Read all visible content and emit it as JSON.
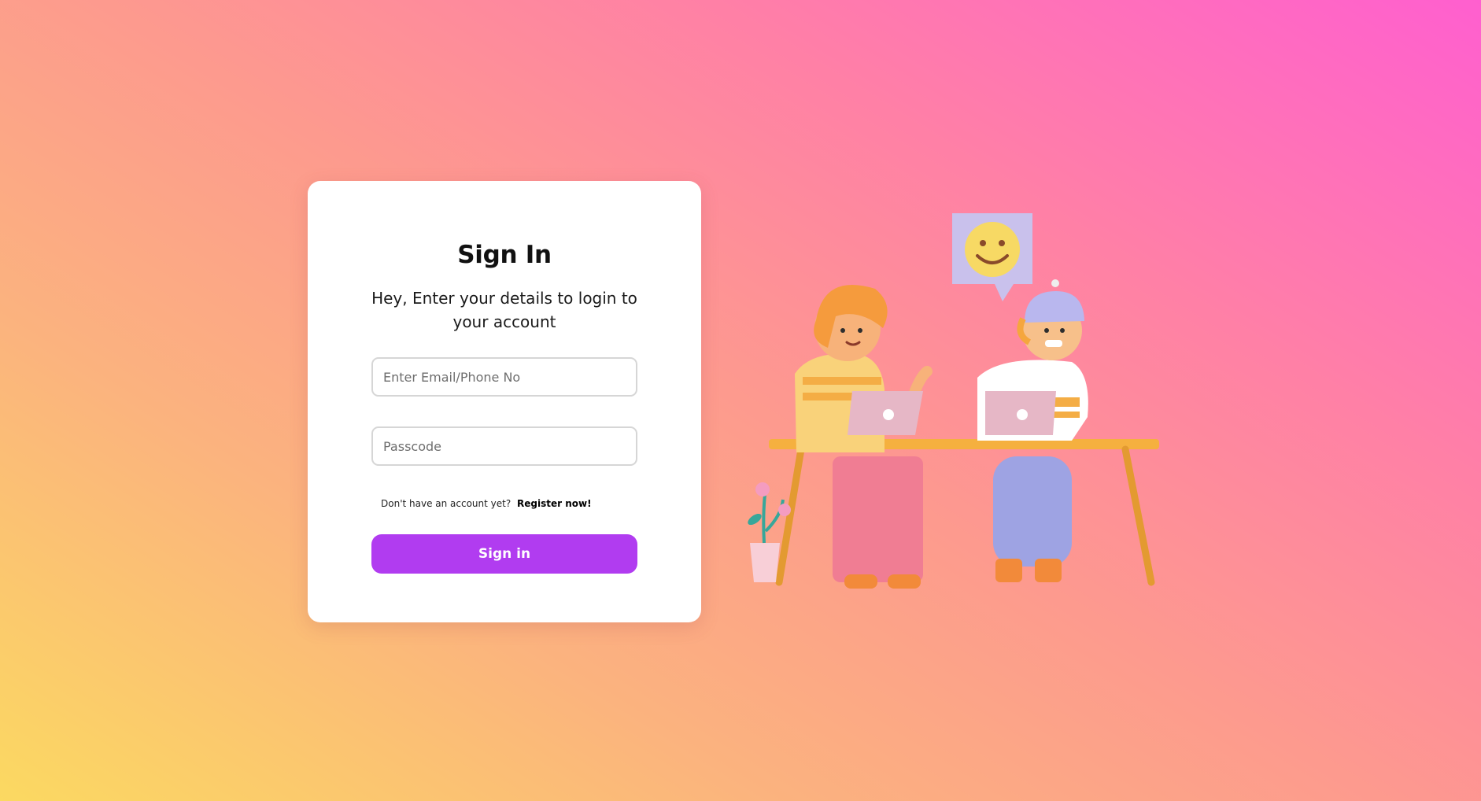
{
  "login": {
    "title": "Sign In",
    "subtitle": "Hey, Enter your details to login to your account",
    "email_placeholder": "Enter Email/Phone No",
    "password_placeholder": "Passcode",
    "register_prompt": "Don't have an account yet?",
    "register_link": "Register now!",
    "signin_label": "Sign in"
  },
  "colors": {
    "accent": "#b13cf0",
    "card": "#ffffff",
    "gradient_start": "#fbd961",
    "gradient_end": "#ff5fcf"
  },
  "illustration": {
    "icon": "two-people-at-desk-illustration",
    "speech_bubble_icon": "smiley-face-icon"
  }
}
